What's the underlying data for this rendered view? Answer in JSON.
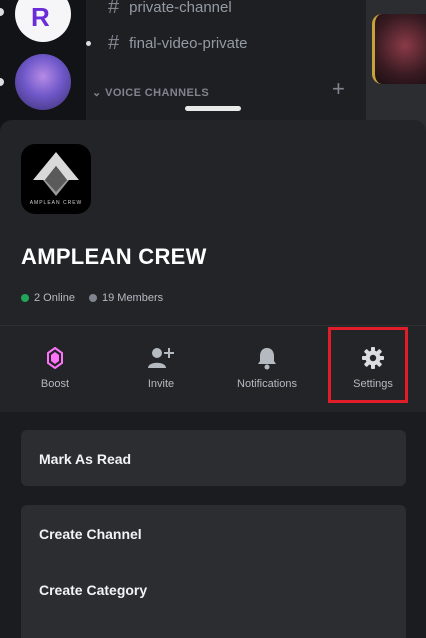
{
  "background": {
    "channels": [
      {
        "name": "private-channel"
      },
      {
        "name": "final-video-private"
      }
    ],
    "voice_header": "VOICE CHANNELS"
  },
  "server": {
    "name": "AMPLEAN CREW",
    "logo_text": "AMPLEAN CREW",
    "online": "2 Online",
    "members": "19 Members"
  },
  "actions": [
    {
      "label": "Boost",
      "icon": "boost-icon"
    },
    {
      "label": "Invite",
      "icon": "add-user-icon"
    },
    {
      "label": "Notifications",
      "icon": "bell-icon"
    },
    {
      "label": "Settings",
      "icon": "gear-icon"
    }
  ],
  "menu": {
    "mark_as_read": "Mark As Read",
    "create_channel": "Create Channel",
    "create_category": "Create Category"
  },
  "colors": {
    "online": "#23a559",
    "boost": "#ff73fa",
    "highlight": "#e11d2a"
  }
}
